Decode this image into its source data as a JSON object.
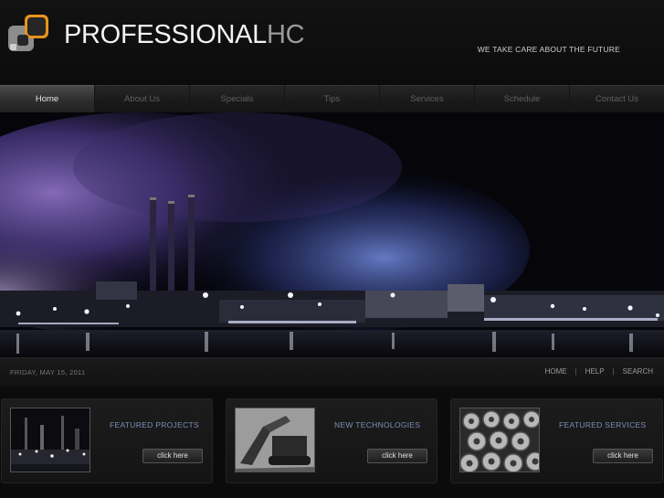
{
  "header": {
    "logo_main": "PROFESSIONAL",
    "logo_suffix": "HC",
    "tagline": "WE TAKE CARE ABOUT THE FUTURE",
    "colors": {
      "logo_accent": "#e8931d",
      "logo_gray": "#8a8a8a"
    }
  },
  "nav": {
    "items": [
      {
        "label": "Home",
        "active": true
      },
      {
        "label": "About Us"
      },
      {
        "label": "Specials"
      },
      {
        "label": "Tips"
      },
      {
        "label": "Services"
      },
      {
        "label": "Schedule"
      },
      {
        "label": "Contact Us"
      }
    ]
  },
  "infobar": {
    "date": "FRIDAY, MAY 15, 2011",
    "links": [
      "HOME",
      "HELP",
      "SEARCH"
    ],
    "separator": "|"
  },
  "features": [
    {
      "title": "FEATURED PROJECTS",
      "button": "click here",
      "icon": "refinery-thumbnail"
    },
    {
      "title": "NEW TECHNOLOGIES",
      "button": "click here",
      "icon": "excavator-thumbnail"
    },
    {
      "title": "FEATURED SERVICES",
      "button": "click here",
      "icon": "steel-coils-thumbnail"
    }
  ]
}
